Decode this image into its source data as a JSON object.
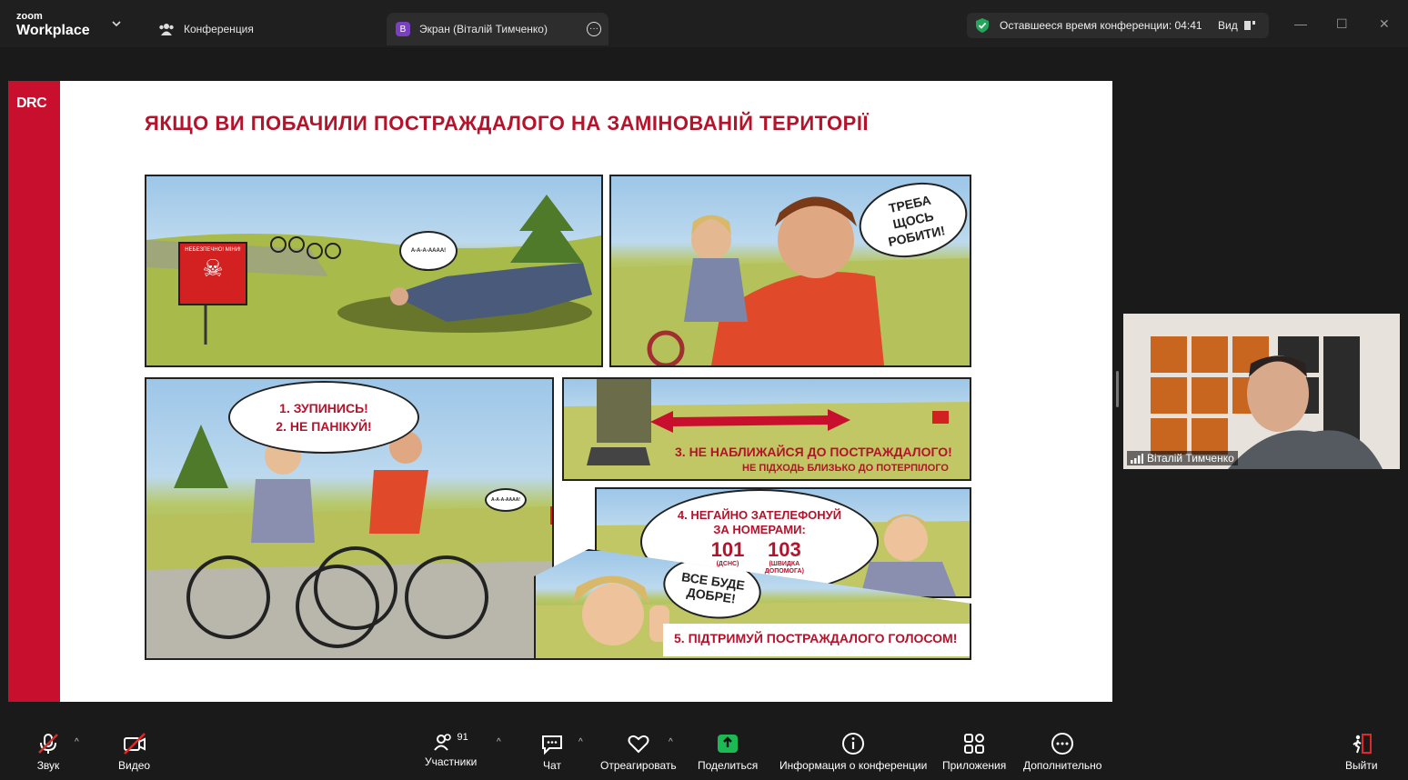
{
  "app": {
    "logo_line1": "zoom",
    "logo_line2": "Workplace"
  },
  "tabs": {
    "conference": "Конференция",
    "screen_badge": "В",
    "screen": "Экран (Віталій Тимченко)"
  },
  "header": {
    "timer_label": "Оставшееся время конференции: 04:41",
    "view_label": "Вид"
  },
  "slide": {
    "brand": "DRC",
    "title": "ЯКЩО ВИ ПОБАЧИЛИ ПОСТРАЖДАЛОГО НА ЗАМІНОВАНІЙ ТЕРИТОРІЇ",
    "sign_text": "НЕБЕЗПЕЧНО! МІНИ!",
    "cry_text": "А-А-А-АААА!",
    "panel2_bubble": "ТРЕБА ЩОСЬ РОБИТИ!",
    "step12_bubble_1": "1. ЗУПИНИСЬ!",
    "step12_bubble_2": "2. НЕ ПАНІКУЙ!",
    "step3_main": "3. НЕ НАБЛИЖАЙСЯ ДО ПОСТРАЖДАЛОГО!",
    "step3_sub": "НЕ ПІДХОДЬ БЛИЗЬКО ДО ПОТЕРПІЛОГО",
    "step4_line1": "4. НЕГАЙНО ЗАТЕЛЕФОНУЙ",
    "step4_line2": "ЗА НОМЕРАМИ:",
    "num1": "101",
    "num1_label": "(ДСНС)",
    "num2": "103",
    "num2_label": "(ШВИДКА ДОПОМОГА)",
    "step5_bubble": "ВСЕ БУДЕ ДОБРЕ!",
    "step5_caption": "5. ПІДТРИМУЙ ПОСТРАЖДАЛОГО ГОЛОСОМ!"
  },
  "participant": {
    "name": "Віталій Тимченко"
  },
  "toolbar": {
    "audio": "Звук",
    "video": "Видео",
    "participants": "Участники",
    "participants_count": "91",
    "chat": "Чат",
    "react": "Отреагировать",
    "share": "Поделиться",
    "info": "Информация о конференции",
    "apps": "Приложения",
    "more": "Дополнительно",
    "leave": "Выйти"
  },
  "colors": {
    "brand_red": "#c8102e",
    "share_green": "#1db954",
    "leave_red": "#e02828",
    "shield_green": "#23a55a"
  }
}
